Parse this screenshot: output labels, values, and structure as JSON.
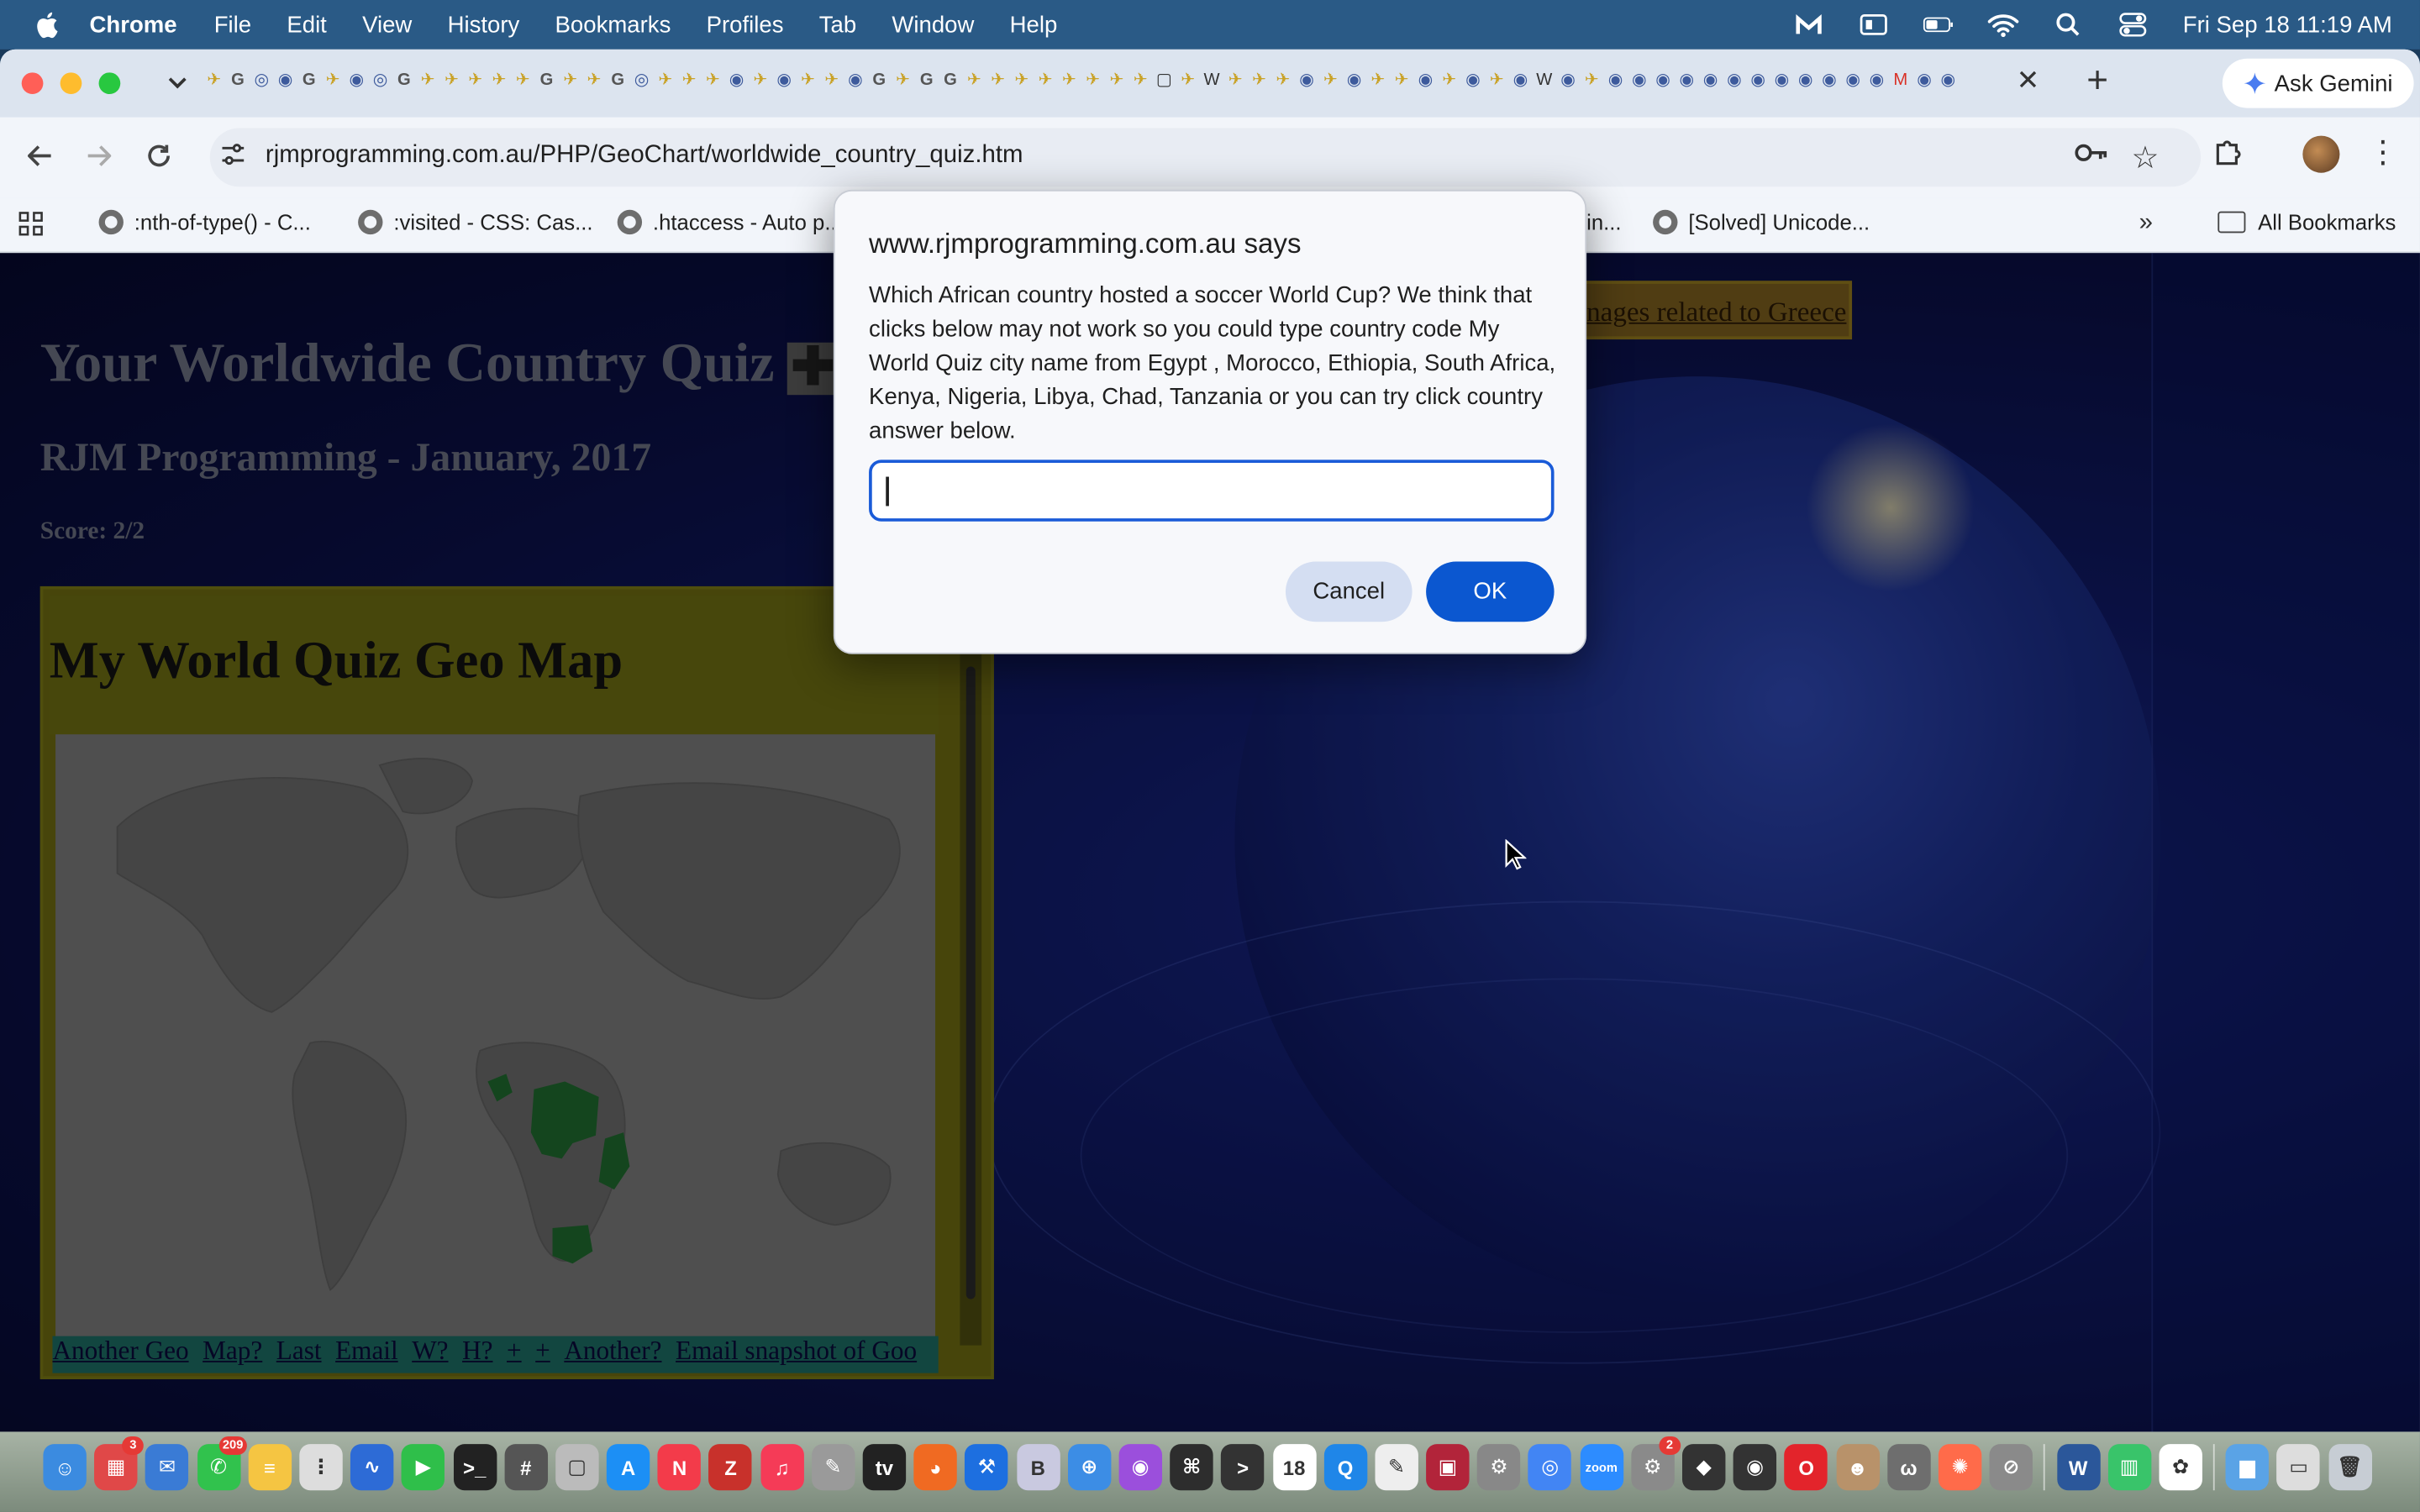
{
  "menubar": {
    "app": "Chrome",
    "items": [
      "File",
      "Edit",
      "View",
      "History",
      "Bookmarks",
      "Profiles",
      "Tab",
      "Window",
      "Help"
    ],
    "clock": "Fri Sep 18  11:19 AM"
  },
  "browser": {
    "ask_gemini": "Ask Gemini",
    "url": "rjmprogramming.com.au/PHP/GeoChart/worldwide_country_quiz.htm",
    "bookmarks": [
      ":nth-of-type() - C...",
      ":visited - CSS: Cas...",
      ".htaccess - Auto p...",
      "in...",
      "[Solved] Unicode..."
    ],
    "all_bookmarks": "All Bookmarks"
  },
  "page": {
    "title": "Your Worldwide Country Quiz",
    "plus": "✚",
    "subtitle": "RJM Programming - January, 2017",
    "score": "Score: 2/2",
    "greece_link": "nages related to Greece",
    "map_title": "My World Quiz Geo Map",
    "links": [
      "Another Geo",
      "Map?",
      "Last",
      "Email",
      "W?",
      "H?",
      "+",
      "+",
      "Another?",
      "Email snapshot of Goo"
    ]
  },
  "dialog": {
    "title": "www.rjmprogramming.com.au says",
    "message": "Which African country hosted a soccer World Cup?  We think that clicks below may not work so you could type country code My World Quiz city name from  Egypt , Morocco, Ethiopia, South Africa, Kenya, Nigeria, Libya, Chad, Tanzania or you can try click country answer below.",
    "input_value": "",
    "cancel": "Cancel",
    "ok": "OK"
  },
  "dock": {
    "mail_badge": "3",
    "messages_badge": "209",
    "calendar_day": "18",
    "settings_badge": "2"
  },
  "colors": {
    "accent": "#0b57d0",
    "map_highlight": "#1f6b2e",
    "page_bg": "#0a0f44"
  }
}
